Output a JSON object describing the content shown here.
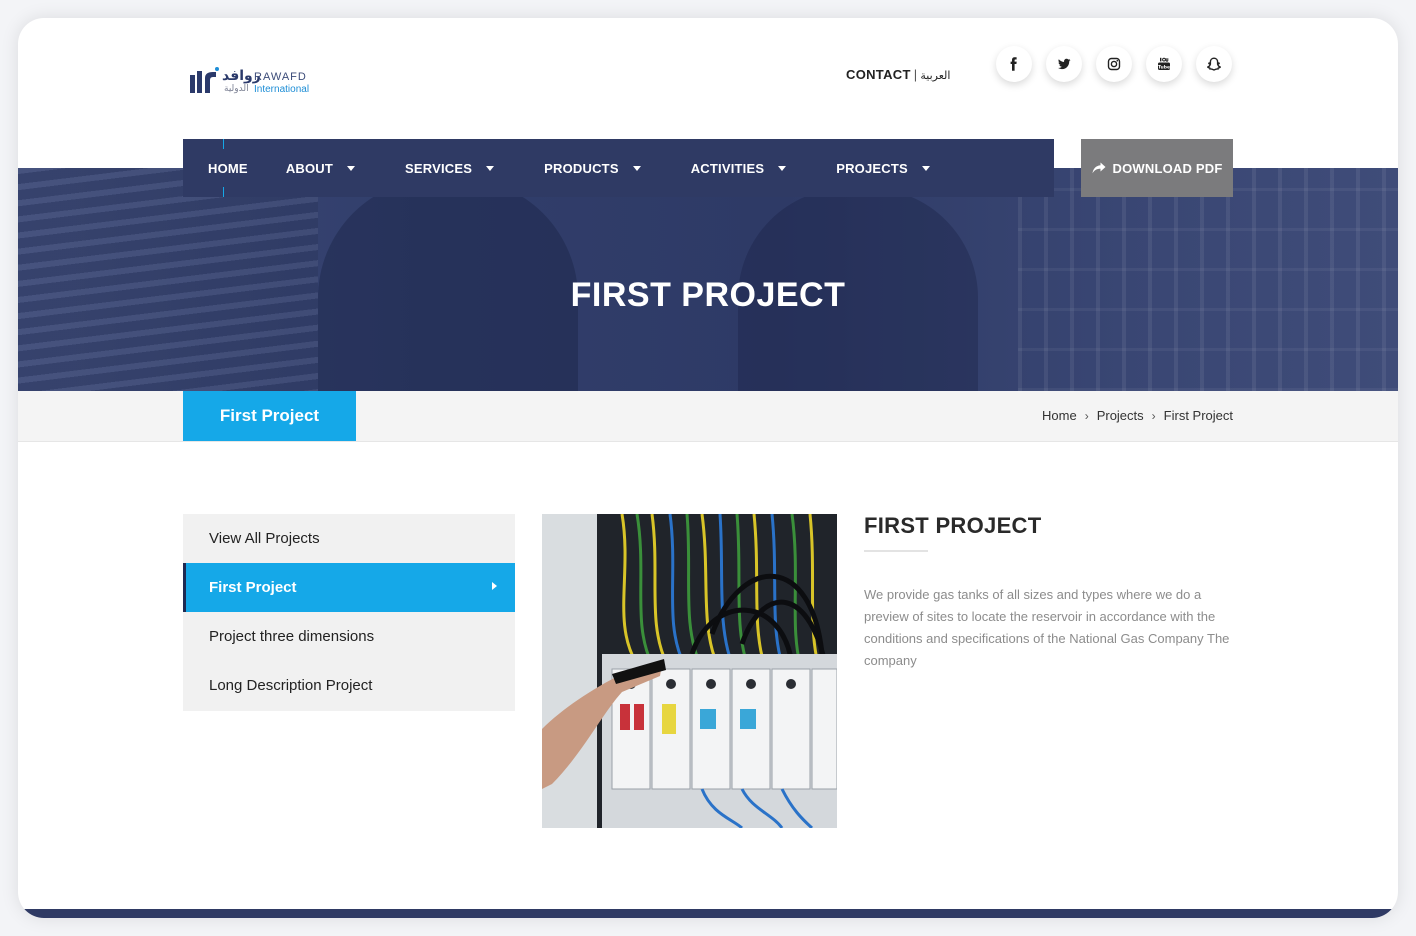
{
  "logo": {
    "ar_name": "روافد",
    "en_name": "RAWAFD",
    "ar_sub": "الدولية",
    "en_sub": "International"
  },
  "toplinks": {
    "contact": "CONTACT",
    "separator": "|",
    "arabic": "العربية"
  },
  "socials": [
    "facebook-icon",
    "twitter-icon",
    "instagram-icon",
    "youtube-icon",
    "snapchat-icon"
  ],
  "nav": {
    "items": [
      {
        "label": "HOME",
        "dropdown": false
      },
      {
        "label": "ABOUT",
        "dropdown": true
      },
      {
        "label": "SERVICES",
        "dropdown": true
      },
      {
        "label": "PRODUCTS",
        "dropdown": true
      },
      {
        "label": "ACTIVITIES",
        "dropdown": true
      },
      {
        "label": "PROJECTS",
        "dropdown": true
      }
    ],
    "download_label": "DOWNLOAD PDF"
  },
  "hero": {
    "title": "FIRST PROJECT"
  },
  "crumb": {
    "tab_label": "First Project",
    "items": [
      "Home",
      "Projects",
      "First Project"
    ]
  },
  "sidebar": {
    "items": [
      {
        "label": "View All Projects"
      },
      {
        "label": "First Project"
      },
      {
        "label": "Project three dimensions"
      },
      {
        "label": "Long Description Project"
      }
    ]
  },
  "content": {
    "title": "FIRST PROJECT",
    "description": "We provide gas tanks of all sizes and types where we do a preview of sites to locate the reservoir in accordance with the conditions and specifications of the National Gas Company The company"
  },
  "colors": {
    "nav_bg": "#2f3a64",
    "accent": "#15a8e8",
    "pdf_btn": "#7b7b7d"
  }
}
